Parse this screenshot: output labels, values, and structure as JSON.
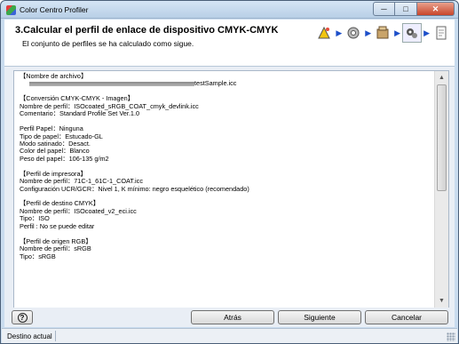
{
  "window": {
    "title": "Color Centro Profiler",
    "minimize": "─",
    "maximize": "□",
    "close": "✕"
  },
  "header": {
    "title": "3.Calcular el perfil de enlace de dispositivo CMYK-CMYK",
    "subtitle": "El conjunto de perfiles se ha calculado como sigue.",
    "step_icons": [
      "wizard-icon",
      "gear-icon",
      "package-icon",
      "print-gears-icon",
      "document-icon"
    ]
  },
  "content": {
    "section_file_label": "【Nombre de archivo】",
    "file_name": "testSample.icc",
    "section_conversion": "【Conversión CMYK-CMYK - Imagen】",
    "profile_name": "Nombre de perfil：ISOcoated_sRGB_COAT_cmyk_devlink.icc",
    "comment": "Comentario：Standard Profile Set Ver.1.0",
    "paper_profile": "Perfil Papel：Ninguna",
    "paper_type": "Tipo de papel：Estucado-GL",
    "screen_mode": "Modo satinado：Desact.",
    "paper_color": "Color del papel：Blanco",
    "paper_weight": "Peso del papel：106-135 g/m2",
    "section_printer": "【Perfil de impresora】",
    "printer_profile_name": "Nombre de perfil：71C-1_61C-1_COAT.icc",
    "ucr_gcr": "Configuración UCR/GCR：Nivel 1, K mínimo: negro esquelético (recomendado)",
    "section_dest": "【Perfil de destino CMYK】",
    "dest_profile_name": "Nombre de perfil：ISOcoated_v2_eci.icc",
    "dest_type": "Tipo：ISO",
    "dest_note": "Perfil : No se puede editar",
    "section_rgb": "【Perfil de origen RGB】",
    "rgb_profile_name": "Nombre de perfil：sRGB",
    "rgb_type": "Tipo：sRGB"
  },
  "buttons": {
    "help": "?",
    "back": "Atrás",
    "next": "Siguiente",
    "cancel": "Cancelar"
  },
  "status": {
    "label": "Destino actual"
  }
}
